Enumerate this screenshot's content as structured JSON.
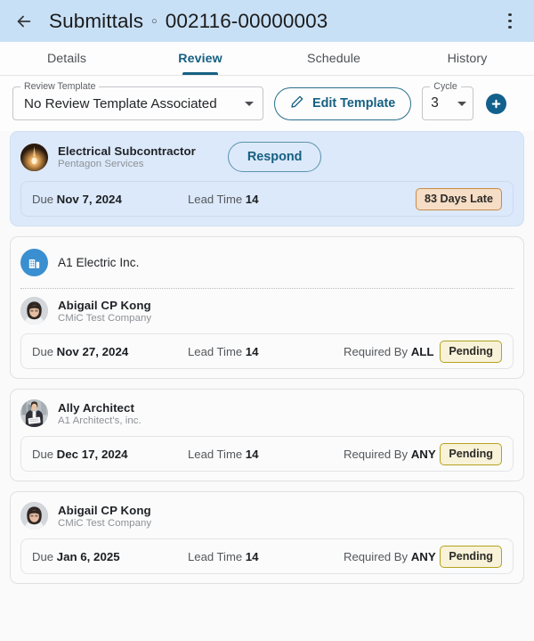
{
  "header": {
    "back_icon": "arrow-left-icon",
    "module_title": "Submittals",
    "separator": "○",
    "record_code": "002116-00000003",
    "overflow_icon": "more-vertical-icon",
    "background_color": "#c8e0f6"
  },
  "tabs": {
    "items": [
      {
        "label": "Details",
        "active": false
      },
      {
        "label": "Review",
        "active": true
      },
      {
        "label": "Schedule",
        "active": false
      },
      {
        "label": "History",
        "active": false
      }
    ],
    "active_color": "#156082"
  },
  "toolbar": {
    "review_template": {
      "legend": "Review Template",
      "value": "No Review Template Associated",
      "caret_icon": "chevron-down-icon"
    },
    "edit_template": {
      "label": "Edit Template",
      "icon": "pencil-icon"
    },
    "cycle": {
      "legend": "Cycle",
      "value": "3",
      "caret_icon": "chevron-down-icon"
    },
    "add_button": {
      "icon": "plus-circle-icon",
      "color": "#12608c"
    }
  },
  "labels": {
    "due": "Due",
    "lead_time": "Lead Time",
    "required_by": "Required By"
  },
  "cards": [
    {
      "type": "person",
      "highlight": true,
      "avatar": "lightbulb-avatar",
      "name": "Electrical Subcontractor",
      "org": "Pentagon Services",
      "action": {
        "label": "Respond",
        "name": "respond-button"
      },
      "meta": {
        "due_label": "Due",
        "due_value": "Nov 7, 2024",
        "lead_label": "Lead Time",
        "lead_value": "14",
        "required_label": "",
        "required_value": "",
        "badge": "83 Days Late",
        "badge_style": "late"
      }
    },
    {
      "type": "company",
      "highlight": false,
      "company_icon": "building-icon",
      "company_name": "A1 Electric Inc.",
      "avatar": "woman-avatar",
      "name": "Abigail CP Kong",
      "org": "CMiC Test Company",
      "meta": {
        "due_label": "Due",
        "due_value": "Nov 27, 2024",
        "lead_label": "Lead Time",
        "lead_value": "14",
        "required_label": "Required By",
        "required_value": "ALL",
        "badge": "Pending",
        "badge_style": "pending"
      }
    },
    {
      "type": "person",
      "highlight": false,
      "avatar": "architect-avatar",
      "name": "Ally Architect",
      "org": "A1 Architect's, inc.",
      "meta": {
        "due_label": "Due",
        "due_value": "Dec 17, 2024",
        "lead_label": "Lead Time",
        "lead_value": "14",
        "required_label": "Required By",
        "required_value": "ANY",
        "badge": "Pending",
        "badge_style": "pending"
      }
    },
    {
      "type": "person",
      "highlight": false,
      "avatar": "woman-avatar",
      "name": "Abigail CP Kong",
      "org": "CMiC Test Company",
      "meta": {
        "due_label": "Due",
        "due_value": "Jan 6, 2025",
        "lead_label": "Lead Time",
        "lead_value": "14",
        "required_label": "Required By",
        "required_value": "ANY",
        "badge": "Pending",
        "badge_style": "pending"
      }
    }
  ],
  "colors": {
    "accent": "#156082",
    "appbar": "#c8e0f6",
    "highlight_card": "#dce9fa",
    "badge_late_bg": "#f6ddc6",
    "badge_late_border": "#c88b4a",
    "badge_pending_bg": "#f7f2d8",
    "badge_pending_border": "#b5a21f"
  }
}
